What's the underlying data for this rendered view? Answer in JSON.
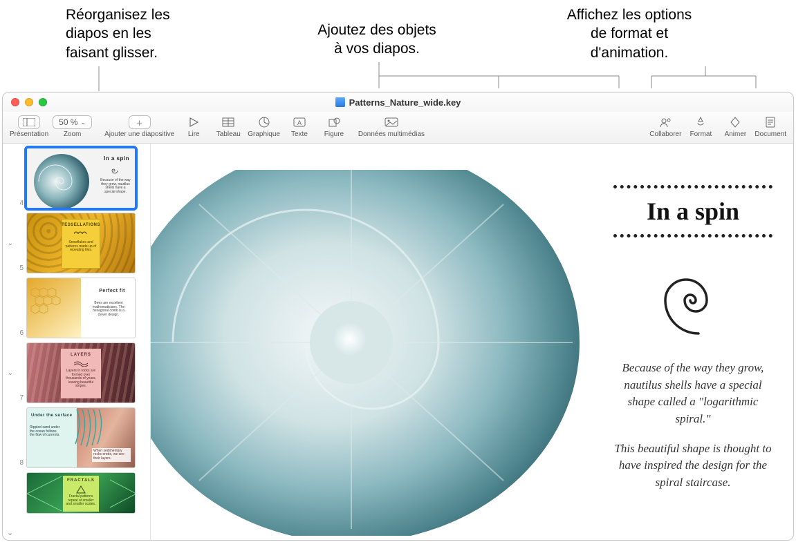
{
  "callouts": {
    "left": "Réorganisez les\ndiapos en les\nfaisant glisser.",
    "mid": "Ajoutez des objets\nà vos diapos.",
    "right": "Affichez les options\nde format et\nd'animation."
  },
  "window": {
    "title": "Patterns_Nature_wide.key"
  },
  "toolbar": {
    "presentation": "Présentation",
    "zoom_label": "Zoom",
    "zoom_value": "50 %",
    "add_slide": "Ajouter une diapositive",
    "play": "Lire",
    "table": "Tableau",
    "chart": "Graphique",
    "text": "Texte",
    "shape": "Figure",
    "media": "Données multimédias",
    "collaborate": "Collaborer",
    "format": "Format",
    "animate": "Animer",
    "document": "Document"
  },
  "navigator": {
    "slides": [
      {
        "num": "4",
        "title": "In a spin",
        "selected": true
      },
      {
        "num": "5",
        "title": "TESSELLATIONS",
        "disclosure": true
      },
      {
        "num": "6",
        "title": "Perfect fit"
      },
      {
        "num": "7",
        "title": "LAYERS",
        "disclosure": true
      },
      {
        "num": "8",
        "title": "Under the surface"
      },
      {
        "num": "",
        "title": "FRACTALS"
      }
    ]
  },
  "slide": {
    "title": "In a spin",
    "body1": "Because of the way they grow, nautilus shells have a special shape called a \"logarithmic spiral.\"",
    "body2": "This beautiful shape is thought to have inspired the design for the spiral staircase."
  }
}
